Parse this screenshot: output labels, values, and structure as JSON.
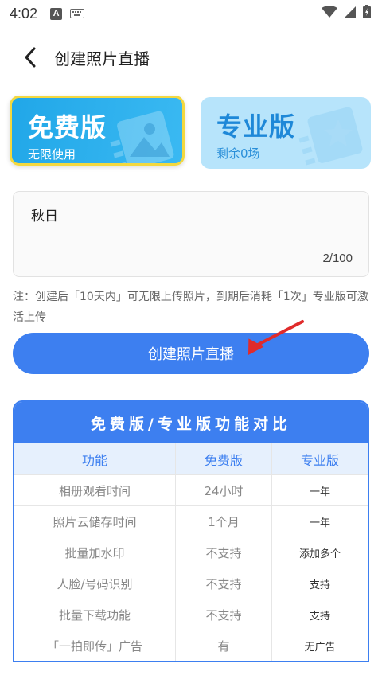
{
  "status": {
    "time": "4:02"
  },
  "header": {
    "title": "创建照片直播"
  },
  "cards": {
    "free": {
      "name": "免费版",
      "sub": "无限使用"
    },
    "pro": {
      "name": "专业版",
      "sub": "剩余0场"
    }
  },
  "input": {
    "value": "秋日",
    "counter": "2/100"
  },
  "note": "注：创建后「10天内」可无限上传照片，到期后消耗「1次」专业版可激活上传",
  "create_button": "创建照片直播",
  "compare": {
    "title": "免费版/专业版功能对比",
    "headers": [
      "功能",
      "免费版",
      "专业版"
    ],
    "rows": [
      [
        "相册观看时间",
        "24小时",
        "一年"
      ],
      [
        "照片云储存时间",
        "1个月",
        "一年"
      ],
      [
        "批量加水印",
        "不支持",
        "添加多个"
      ],
      [
        "人脸/号码识别",
        "不支持",
        "支持"
      ],
      [
        "批量下载功能",
        "不支持",
        "支持"
      ],
      [
        "「一拍即传」广告",
        "有",
        "无广告"
      ]
    ]
  },
  "colors": {
    "accent": "#3d7ff0",
    "free_card": "#21a7e8",
    "pro_card": "#b7e4fb",
    "highlight_border": "#f3d83f",
    "arrow": "#e02b2b"
  }
}
